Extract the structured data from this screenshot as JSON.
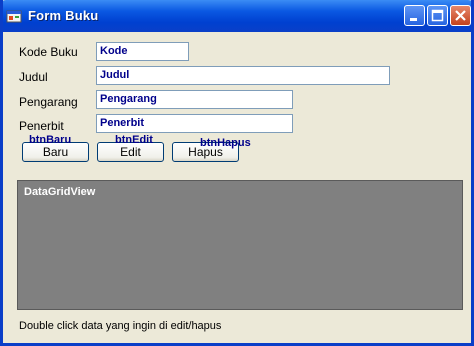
{
  "window": {
    "title": "Form Buku",
    "icon": "form-app-icon",
    "controls": [
      "minimize-icon",
      "maximize-icon",
      "close-icon"
    ]
  },
  "form": {
    "kode": {
      "label": "Kode Buku",
      "value": "Kode"
    },
    "judul": {
      "label": "Judul",
      "value": "Judul"
    },
    "pengarang": {
      "label": "Pengarang",
      "value": "Pengarang"
    },
    "penerbit": {
      "label": "Penerbit",
      "value": "Penerbit"
    }
  },
  "buttons": {
    "baru": {
      "name": "btnBaru",
      "label": "Baru"
    },
    "edit": {
      "name": "btnEdit",
      "label": "Edit"
    },
    "hapus": {
      "name": "btnHapus",
      "label": "Hapus"
    }
  },
  "grid": {
    "label": "DataGridView"
  },
  "hint": "Double click data yang ingin di edit/hapus",
  "colors": {
    "titlebar": "#0a58e2",
    "form_background": "#ece9d8",
    "grid_background": "#808080",
    "field_text": "#00008b",
    "close_button": "#c3421d"
  }
}
